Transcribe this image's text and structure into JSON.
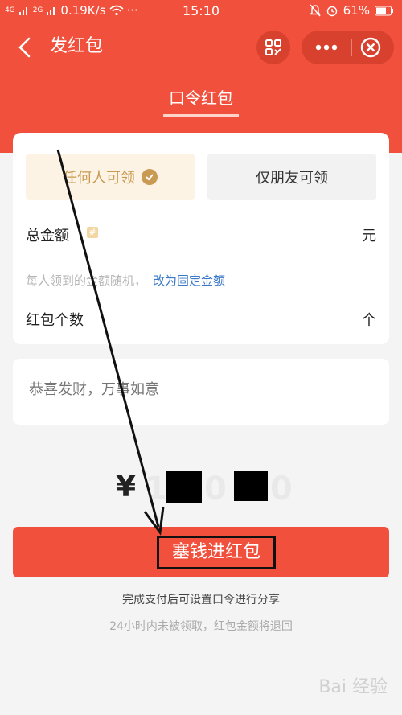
{
  "status_bar": {
    "network_left": "4G",
    "network_right": "2G",
    "speed": "0.19K/s",
    "dots": "···",
    "time": "15:10",
    "battery": "61%"
  },
  "header": {
    "title": "发红包",
    "tab": "口令红包"
  },
  "options": {
    "any": "任何人可领",
    "friends": "仅朋友可领"
  },
  "form": {
    "total_label": "总金额",
    "total_unit": "元",
    "tip": "每人领到的金额随机，",
    "tip_link": "改为固定金额",
    "count_label": "红包个数",
    "count_unit": "个"
  },
  "greeting": {
    "placeholder": "恭喜发财，万事如意"
  },
  "amount": {
    "currency": "¥",
    "digits": [
      "1",
      "0",
      "0",
      "0"
    ]
  },
  "submit": {
    "label": "塞钱进红包"
  },
  "hints": {
    "line1": "完成支付后可设置口令进行分享",
    "line2": "24小时内未被领取，红包金额将退回"
  },
  "watermark": "Bai 经验"
}
